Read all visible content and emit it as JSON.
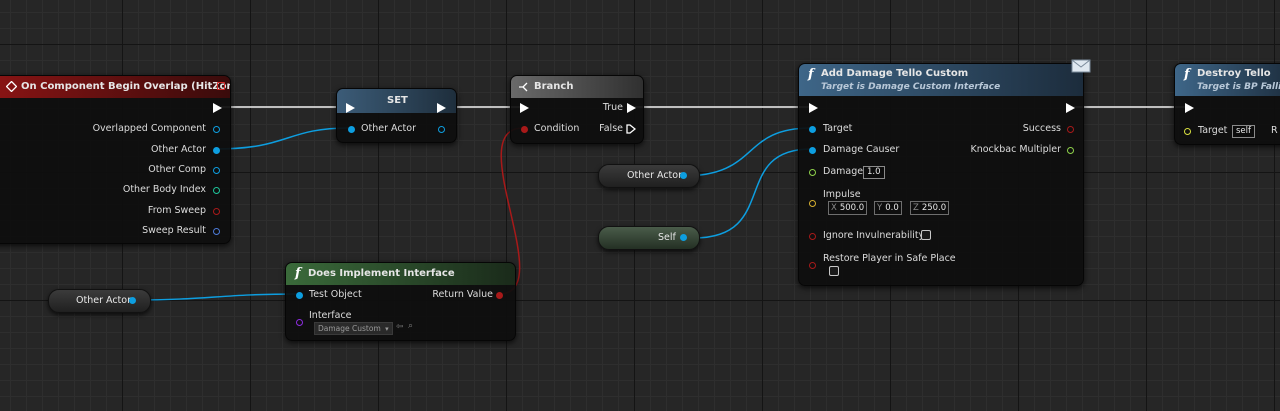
{
  "colors": {
    "exec": "#ffffff",
    "object": "#0d9ee0",
    "boolean": "#a81919",
    "vector": "#d8b030",
    "float": "#8ed14b",
    "struct_hit": "#4d7bd8",
    "int": "#1dc59b",
    "interface": "#8d2ce0",
    "event_header": "#7a1010",
    "function_header": "#2d4a6b",
    "pure_header": "#355c35"
  },
  "begin_overlap": {
    "title": "On Component Begin Overlap (HitZone)",
    "pins": [
      "Overlapped Component",
      "Other Actor",
      "Other Comp",
      "Other Body Index",
      "From Sweep",
      "Sweep Result"
    ]
  },
  "set_node": {
    "title": "SET",
    "input_label": "Other Actor"
  },
  "branch": {
    "title": "Branch",
    "condition_label": "Condition",
    "true_label": "True",
    "false_label": "False"
  },
  "add_damage": {
    "title": "Add Damage Tello Custom",
    "subtitle": "Target is Damage Custom Interface",
    "target_label": "Target",
    "damage_causer_label": "Damage Causer",
    "damage_label": "Damage",
    "damage_value": "1.0",
    "impulse_label": "Impulse",
    "impulse_x_axis": "X",
    "impulse_x": "500.0",
    "impulse_y_axis": "Y",
    "impulse_y": "0.0",
    "impulse_z_axis": "Z",
    "impulse_z": "250.0",
    "ignore_invulnerability_label": "Ignore Invulnerability",
    "restore_player_label": "Restore Player in Safe Place",
    "success_label": "Success",
    "knockback_label": "Knockbac Multipler"
  },
  "destroy": {
    "title": "Destroy Tello",
    "subtitle": "Target is BP Falling",
    "target_label": "Target",
    "target_value": "self",
    "cut_label": "R"
  },
  "implements": {
    "title": "Does Implement Interface",
    "test_object_label": "Test Object",
    "return_label": "Return Value",
    "interface_label": "Interface",
    "interface_value": "Damage Custom"
  },
  "var_other_actor_1": "Other Actor",
  "var_self": "Self",
  "var_other_actor_2": "Other Actor"
}
